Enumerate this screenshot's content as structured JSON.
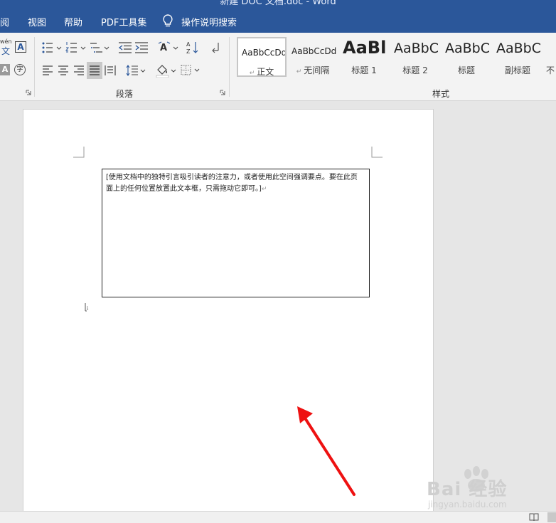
{
  "window": {
    "title": "新建 DOC 文档.doc  -  Word"
  },
  "menu": {
    "items": [
      "阅",
      "视图",
      "帮助",
      "PDF工具集",
      "操作说明搜索"
    ]
  },
  "ribbon": {
    "pinyin_label": "wén",
    "pinyin_char": "文",
    "text_box_glyph": "A",
    "shading_glyph": "A",
    "enclose_glyph": "字",
    "paragraph_group": "段落",
    "styles_group": "样式",
    "styles": [
      {
        "sample": "AaBbCcDd",
        "name": "正文"
      },
      {
        "sample": "AaBbCcDd",
        "name": "无间隔"
      },
      {
        "sample": "AaBl",
        "name": "标题 1"
      },
      {
        "sample": "AaBbC",
        "name": "标题 2"
      },
      {
        "sample": "AaBbC",
        "name": "标题"
      },
      {
        "sample": "AaBbC",
        "name": "副标题"
      },
      {
        "sample": "",
        "name": "不"
      }
    ]
  },
  "document": {
    "text_box_text": "[使用文档中的独特引言吸引读者的注意力，或者使用此空间强调要点。要在此页面上的任何位置放置此文本框，只需拖动它即可。]",
    "paragraph_mark": "↵"
  },
  "watermark": {
    "text": "Bai 经验",
    "url": "jingyan.baidu.com"
  },
  "colors": {
    "title_bar": "#2b579a",
    "arrow": "#ee1111"
  }
}
